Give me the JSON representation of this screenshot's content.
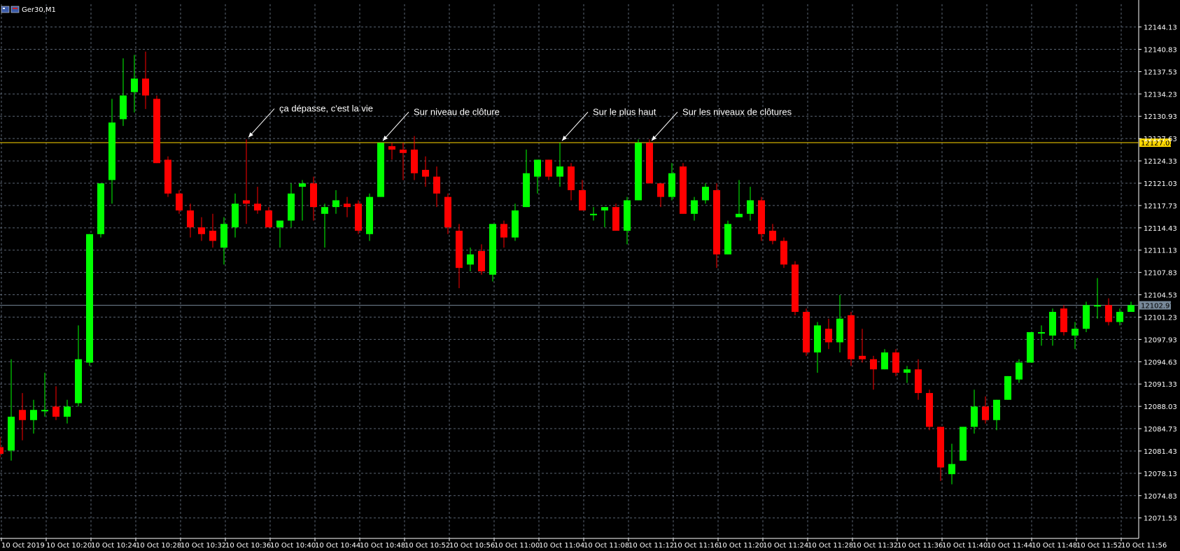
{
  "window": {
    "title": "Ger30,M1"
  },
  "colors": {
    "background": "#000000",
    "grid": "#5a6472",
    "bull": "#00ff00",
    "bear": "#ff0000",
    "hline_resistance": "#ffd700",
    "hline_price": "#778899",
    "resistance_label_bg": "#ffd700",
    "price_label_bg": "#778899",
    "text": "#ffffff"
  },
  "chart_data": {
    "type": "candlestick",
    "symbol": "Ger30",
    "timeframe": "M1",
    "ylim": [
      12068.5,
      12147.5
    ],
    "y_ticks": [
      "12144.13",
      "12140.83",
      "12137.53",
      "12134.23",
      "12130.93",
      "12127.63",
      "12124.33",
      "12121.03",
      "12117.73",
      "12114.43",
      "12111.13",
      "12107.83",
      "12104.53",
      "12101.23",
      "12097.93",
      "12094.63",
      "12091.33",
      "12088.03",
      "12084.73",
      "12081.43",
      "12078.13",
      "12074.83",
      "12071.53"
    ],
    "x_ticks": [
      "10 Oct 2019",
      "10 Oct 10:20",
      "10 Oct 10:24",
      "10 Oct 10:28",
      "10 Oct 10:32",
      "10 Oct 10:36",
      "10 Oct 10:40",
      "10 Oct 10:44",
      "10 Oct 10:48",
      "10 Oct 10:52",
      "10 Oct 10:56",
      "10 Oct 11:00",
      "10 Oct 11:04",
      "10 Oct 11:08",
      "10 Oct 11:12",
      "10 Oct 11:16",
      "10 Oct 11:20",
      "10 Oct 11:24",
      "10 Oct 11:28",
      "10 Oct 11:32",
      "10 Oct 11:36",
      "10 Oct 11:40",
      "10 Oct 11:44",
      "10 Oct 11:48",
      "10 Oct 11:52",
      "10 Oct 11:56"
    ],
    "horizontal_lines": [
      {
        "price": 12127.02,
        "label": "12127.02",
        "role": "resistance"
      },
      {
        "price": 12102.97,
        "label": "12102.97",
        "role": "price"
      }
    ],
    "candles": [
      {
        "o": 12082.0,
        "h": 12083.5,
        "l": 12080.5,
        "c": 12081.0
      },
      {
        "o": 12081.5,
        "h": 12095.0,
        "l": 12080.0,
        "c": 12086.5
      },
      {
        "o": 12087.5,
        "h": 12090.0,
        "l": 12083.0,
        "c": 12086.0
      },
      {
        "o": 12086.0,
        "h": 12089.0,
        "l": 12084.0,
        "c": 12087.5
      },
      {
        "o": 12087.5,
        "h": 12093.0,
        "l": 12086.5,
        "c": 12087.5
      },
      {
        "o": 12088.0,
        "h": 12091.0,
        "l": 12086.0,
        "c": 12086.5
      },
      {
        "o": 12086.5,
        "h": 12089.0,
        "l": 12085.5,
        "c": 12088.0
      },
      {
        "o": 12088.5,
        "h": 12100.0,
        "l": 12088.0,
        "c": 12095.0
      },
      {
        "o": 12094.5,
        "h": 12113.5,
        "l": 12094.0,
        "c": 12113.5
      },
      {
        "o": 12113.5,
        "h": 12121.0,
        "l": 12113.0,
        "c": 12121.0
      },
      {
        "o": 12121.5,
        "h": 12133.5,
        "l": 12118.0,
        "c": 12130.0
      },
      {
        "o": 12130.5,
        "h": 12139.5,
        "l": 12129.5,
        "c": 12134.0
      },
      {
        "o": 12134.5,
        "h": 12140.0,
        "l": 12131.5,
        "c": 12136.5
      },
      {
        "o": 12136.5,
        "h": 12140.5,
        "l": 12132.0,
        "c": 12134.0
      },
      {
        "o": 12133.5,
        "h": 12134.0,
        "l": 12124.0,
        "c": 12124.0
      },
      {
        "o": 12124.5,
        "h": 12125.0,
        "l": 12119.0,
        "c": 12119.5
      },
      {
        "o": 12119.5,
        "h": 12120.0,
        "l": 12116.5,
        "c": 12117.0
      },
      {
        "o": 12117.0,
        "h": 12118.0,
        "l": 12113.0,
        "c": 12114.5
      },
      {
        "o": 12114.5,
        "h": 12116.0,
        "l": 12112.5,
        "c": 12113.5
      },
      {
        "o": 12114.0,
        "h": 12116.5,
        "l": 12111.5,
        "c": 12112.5
      },
      {
        "o": 12111.5,
        "h": 12116.0,
        "l": 12109.0,
        "c": 12115.0
      },
      {
        "o": 12114.5,
        "h": 12119.5,
        "l": 12113.0,
        "c": 12118.0
      },
      {
        "o": 12118.5,
        "h": 12127.5,
        "l": 12115.0,
        "c": 12118.0
      },
      {
        "o": 12118.0,
        "h": 12120.5,
        "l": 12116.5,
        "c": 12117.0
      },
      {
        "o": 12117.0,
        "h": 12117.5,
        "l": 12114.5,
        "c": 12114.5
      },
      {
        "o": 12114.5,
        "h": 12115.5,
        "l": 12111.5,
        "c": 12115.5
      },
      {
        "o": 12115.5,
        "h": 12121.0,
        "l": 12114.5,
        "c": 12119.5
      },
      {
        "o": 12120.5,
        "h": 12121.5,
        "l": 12115.5,
        "c": 12121.0
      },
      {
        "o": 12121.0,
        "h": 12122.0,
        "l": 12115.5,
        "c": 12117.5
      },
      {
        "o": 12116.5,
        "h": 12118.0,
        "l": 12111.5,
        "c": 12117.5
      },
      {
        "o": 12117.5,
        "h": 12120.0,
        "l": 12116.5,
        "c": 12118.5
      },
      {
        "o": 12118.0,
        "h": 12119.0,
        "l": 12116.0,
        "c": 12117.5
      },
      {
        "o": 12118.0,
        "h": 12118.5,
        "l": 12113.5,
        "c": 12114.0
      },
      {
        "o": 12113.5,
        "h": 12119.5,
        "l": 12112.5,
        "c": 12119.0
      },
      {
        "o": 12119.0,
        "h": 12127.0,
        "l": 12119.0,
        "c": 12127.0
      },
      {
        "o": 12126.5,
        "h": 12127.0,
        "l": 12124.5,
        "c": 12126.0
      },
      {
        "o": 12126.0,
        "h": 12127.0,
        "l": 12121.5,
        "c": 12125.5
      },
      {
        "o": 12126.0,
        "h": 12128.0,
        "l": 12121.5,
        "c": 12122.5
      },
      {
        "o": 12123.0,
        "h": 12125.0,
        "l": 12120.5,
        "c": 12122.0
      },
      {
        "o": 12122.0,
        "h": 12123.5,
        "l": 12117.5,
        "c": 12119.5
      },
      {
        "o": 12119.0,
        "h": 12119.5,
        "l": 12113.5,
        "c": 12114.5
      },
      {
        "o": 12114.0,
        "h": 12115.0,
        "l": 12105.5,
        "c": 12108.5
      },
      {
        "o": 12109.0,
        "h": 12111.5,
        "l": 12108.0,
        "c": 12110.5
      },
      {
        "o": 12111.0,
        "h": 12112.0,
        "l": 12107.5,
        "c": 12108.0
      },
      {
        "o": 12107.5,
        "h": 12115.0,
        "l": 12106.5,
        "c": 12115.0
      },
      {
        "o": 12115.0,
        "h": 12115.5,
        "l": 12111.5,
        "c": 12113.0
      },
      {
        "o": 12113.0,
        "h": 12118.0,
        "l": 12112.5,
        "c": 12117.0
      },
      {
        "o": 12117.5,
        "h": 12126.0,
        "l": 12117.5,
        "c": 12122.5
      },
      {
        "o": 12122.0,
        "h": 12124.5,
        "l": 12119.5,
        "c": 12124.5
      },
      {
        "o": 12124.5,
        "h": 12124.5,
        "l": 12121.5,
        "c": 12122.0
      },
      {
        "o": 12122.0,
        "h": 12127.0,
        "l": 12120.5,
        "c": 12123.5
      },
      {
        "o": 12123.5,
        "h": 12124.0,
        "l": 12118.5,
        "c": 12120.0
      },
      {
        "o": 12120.0,
        "h": 12121.5,
        "l": 12117.0,
        "c": 12117.0
      },
      {
        "o": 12116.5,
        "h": 12117.5,
        "l": 12115.5,
        "c": 12116.5
      },
      {
        "o": 12117.0,
        "h": 12117.5,
        "l": 12114.5,
        "c": 12117.5
      },
      {
        "o": 12117.5,
        "h": 12118.0,
        "l": 12114.0,
        "c": 12114.0
      },
      {
        "o": 12114.0,
        "h": 12119.0,
        "l": 12112.0,
        "c": 12118.5
      },
      {
        "o": 12118.5,
        "h": 12127.5,
        "l": 12118.5,
        "c": 12127.0
      },
      {
        "o": 12127.0,
        "h": 12127.5,
        "l": 12121.0,
        "c": 12121.0
      },
      {
        "o": 12121.0,
        "h": 12121.0,
        "l": 12117.5,
        "c": 12119.0
      },
      {
        "o": 12119.0,
        "h": 12124.0,
        "l": 12118.5,
        "c": 12122.5
      },
      {
        "o": 12123.5,
        "h": 12124.0,
        "l": 12116.5,
        "c": 12116.5
      },
      {
        "o": 12116.5,
        "h": 12119.0,
        "l": 12115.5,
        "c": 12118.5
      },
      {
        "o": 12118.5,
        "h": 12121.0,
        "l": 12118.0,
        "c": 12120.5
      },
      {
        "o": 12120.0,
        "h": 12121.0,
        "l": 12108.5,
        "c": 12110.5
      },
      {
        "o": 12110.5,
        "h": 12115.5,
        "l": 12110.5,
        "c": 12115.0
      },
      {
        "o": 12116.0,
        "h": 12121.5,
        "l": 12116.0,
        "c": 12116.5
      },
      {
        "o": 12116.5,
        "h": 12120.5,
        "l": 12115.5,
        "c": 12118.5
      },
      {
        "o": 12118.5,
        "h": 12119.0,
        "l": 12112.5,
        "c": 12113.5
      },
      {
        "o": 12114.0,
        "h": 12115.0,
        "l": 12112.0,
        "c": 12112.5
      },
      {
        "o": 12112.5,
        "h": 12113.0,
        "l": 12108.5,
        "c": 12109.0
      },
      {
        "o": 12109.0,
        "h": 12109.5,
        "l": 12101.5,
        "c": 12102.0
      },
      {
        "o": 12102.0,
        "h": 12102.5,
        "l": 12095.5,
        "c": 12096.0
      },
      {
        "o": 12096.0,
        "h": 12100.5,
        "l": 12093.0,
        "c": 12100.0
      },
      {
        "o": 12099.5,
        "h": 12101.0,
        "l": 12096.5,
        "c": 12097.5
      },
      {
        "o": 12097.5,
        "h": 12104.5,
        "l": 12096.0,
        "c": 12101.0
      },
      {
        "o": 12101.5,
        "h": 12102.0,
        "l": 12094.0,
        "c": 12095.0
      },
      {
        "o": 12095.5,
        "h": 12099.5,
        "l": 12094.5,
        "c": 12095.0
      },
      {
        "o": 12095.0,
        "h": 12095.5,
        "l": 12090.5,
        "c": 12093.5
      },
      {
        "o": 12093.5,
        "h": 12096.5,
        "l": 12093.5,
        "c": 12096.0
      },
      {
        "o": 12096.0,
        "h": 12096.5,
        "l": 12092.5,
        "c": 12093.0
      },
      {
        "o": 12093.0,
        "h": 12094.0,
        "l": 12091.5,
        "c": 12093.5
      },
      {
        "o": 12093.5,
        "h": 12095.0,
        "l": 12089.0,
        "c": 12090.0
      },
      {
        "o": 12090.0,
        "h": 12090.5,
        "l": 12084.5,
        "c": 12085.0
      },
      {
        "o": 12085.0,
        "h": 12085.0,
        "l": 12077.0,
        "c": 12079.0
      },
      {
        "o": 12078.0,
        "h": 12082.5,
        "l": 12076.5,
        "c": 12079.5
      },
      {
        "o": 12080.0,
        "h": 12085.0,
        "l": 12080.0,
        "c": 12085.0
      },
      {
        "o": 12085.0,
        "h": 12090.5,
        "l": 12084.0,
        "c": 12088.0
      },
      {
        "o": 12088.0,
        "h": 12089.5,
        "l": 12085.5,
        "c": 12086.0
      },
      {
        "o": 12086.0,
        "h": 12089.0,
        "l": 12084.5,
        "c": 12089.0
      },
      {
        "o": 12089.0,
        "h": 12092.5,
        "l": 12089.0,
        "c": 12092.5
      },
      {
        "o": 12092.0,
        "h": 12095.0,
        "l": 12091.5,
        "c": 12094.5
      },
      {
        "o": 12094.5,
        "h": 12099.0,
        "l": 12094.5,
        "c": 12099.0
      },
      {
        "o": 12099.0,
        "h": 12100.0,
        "l": 12097.0,
        "c": 12099.0
      },
      {
        "o": 12098.5,
        "h": 12102.5,
        "l": 12097.0,
        "c": 12102.0
      },
      {
        "o": 12102.5,
        "h": 12103.0,
        "l": 12098.5,
        "c": 12099.0
      },
      {
        "o": 12098.5,
        "h": 12100.5,
        "l": 12096.5,
        "c": 12099.5
      },
      {
        "o": 12099.5,
        "h": 12103.5,
        "l": 12099.0,
        "c": 12103.0
      },
      {
        "o": 12103.0,
        "h": 12107.0,
        "l": 12101.0,
        "c": 12103.0
      },
      {
        "o": 12103.0,
        "h": 12104.0,
        "l": 12100.0,
        "c": 12100.5
      },
      {
        "o": 12100.5,
        "h": 12102.5,
        "l": 12100.0,
        "c": 12102.0
      },
      {
        "o": 12102.0,
        "h": 12103.5,
        "l": 12102.0,
        "c": 12103.0
      }
    ],
    "annotations": [
      {
        "text": "ça dépasse, c'est la vie",
        "target_index": 22,
        "target": "high"
      },
      {
        "text": "Sur niveau de clôture",
        "target_index": 34,
        "target": "close"
      },
      {
        "text": "Sur le plus haut",
        "target_index": 50,
        "target": "high"
      },
      {
        "text": "Sur les niveaux de clôtures",
        "target_index": 58,
        "target": "open"
      }
    ]
  }
}
